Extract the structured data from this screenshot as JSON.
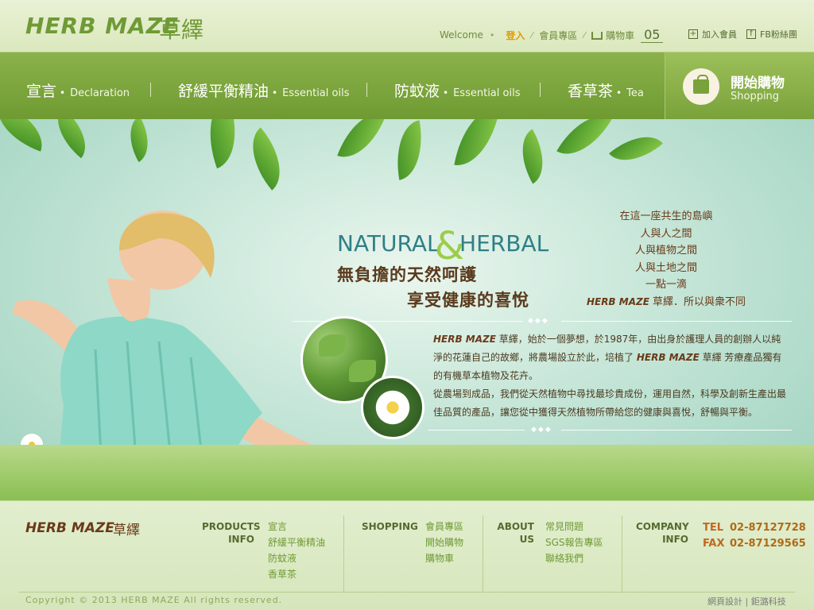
{
  "header": {
    "logo_en": "HERB MAZE",
    "logo_zh": "草繹",
    "welcome": "Welcome",
    "login": "登入",
    "member_zone": "會員專區",
    "cart": "購物車",
    "cart_count": "05",
    "join_member": "加入會員",
    "fb_fans": "FB粉絲團"
  },
  "nav": {
    "items": [
      {
        "zh": "宣言",
        "en": "Declaration"
      },
      {
        "zh": "舒緩平衡精油",
        "en": "Essential oils"
      },
      {
        "zh": "防蚊液",
        "en": "Essential oils"
      },
      {
        "zh": "香草茶",
        "en": "Tea"
      }
    ],
    "shop_zh": "開始購物",
    "shop_en": "Shopping"
  },
  "hero": {
    "natural": "NATURAL",
    "amp": "&",
    "herbal": "HERBAL",
    "slogan1": "無負擔的天然呵護",
    "slogan2": "享受健康的喜悅",
    "poem": [
      "在這一座共生的島嶼",
      "人與人之間",
      "人與植物之間",
      "人與土地之間",
      "一點一滴"
    ],
    "poem_brand": "HERB MAZE",
    "poem_last": "草繹．所以與衆不同",
    "intro_brand1": "HERB MAZE",
    "intro_p1a": "草繹，始於一個夢想，於1987年，由出身於護理人員的創辦人以純淨的花蓮自己的故鄉，將農場設立於此，培植了",
    "intro_brand2": "HERB MAZE",
    "intro_p1b": "草繹 芳療產品獨有的有機草本植物及花卉。",
    "intro_p2": "從農場到成品，我們從天然植物中尋找最珍貴成份，運用自然，科學及創新生產出最佳品質的產品，讓您從中獲得天然植物所帶給您的健康與喜悅，舒暢與平衡。",
    "diamonds": "◆◆◆"
  },
  "footer": {
    "logo_en": "HERB MAZE",
    "logo_zh": "草繹",
    "products_head": [
      "PRODUCTS",
      "INFO"
    ],
    "products": [
      "宣言",
      "舒緩平衡精油",
      "防蚊液",
      "香草茶"
    ],
    "shopping_head": [
      "SHOPPING"
    ],
    "shopping": [
      "會員專區",
      "開始購物",
      "購物車"
    ],
    "about_head": [
      "ABOUT",
      "US"
    ],
    "about": [
      "常見問題",
      "SGS報告專區",
      "聯絡我們"
    ],
    "company_head": [
      "COMPANY",
      "INFO"
    ],
    "tel_label": "TEL",
    "tel": "02-87127728",
    "fax_label": "FAX",
    "fax": "02-87129565",
    "copyright": "Copyright  © 2013 HERB MAZE All rights reserved.",
    "credits": "網頁設計 | 鉅潞科技"
  },
  "colors": {
    "brand_green": "#6f9a35",
    "nav_green": "#7aa23a",
    "accent_orange": "#e39b00",
    "brown": "#5a3a1c"
  }
}
